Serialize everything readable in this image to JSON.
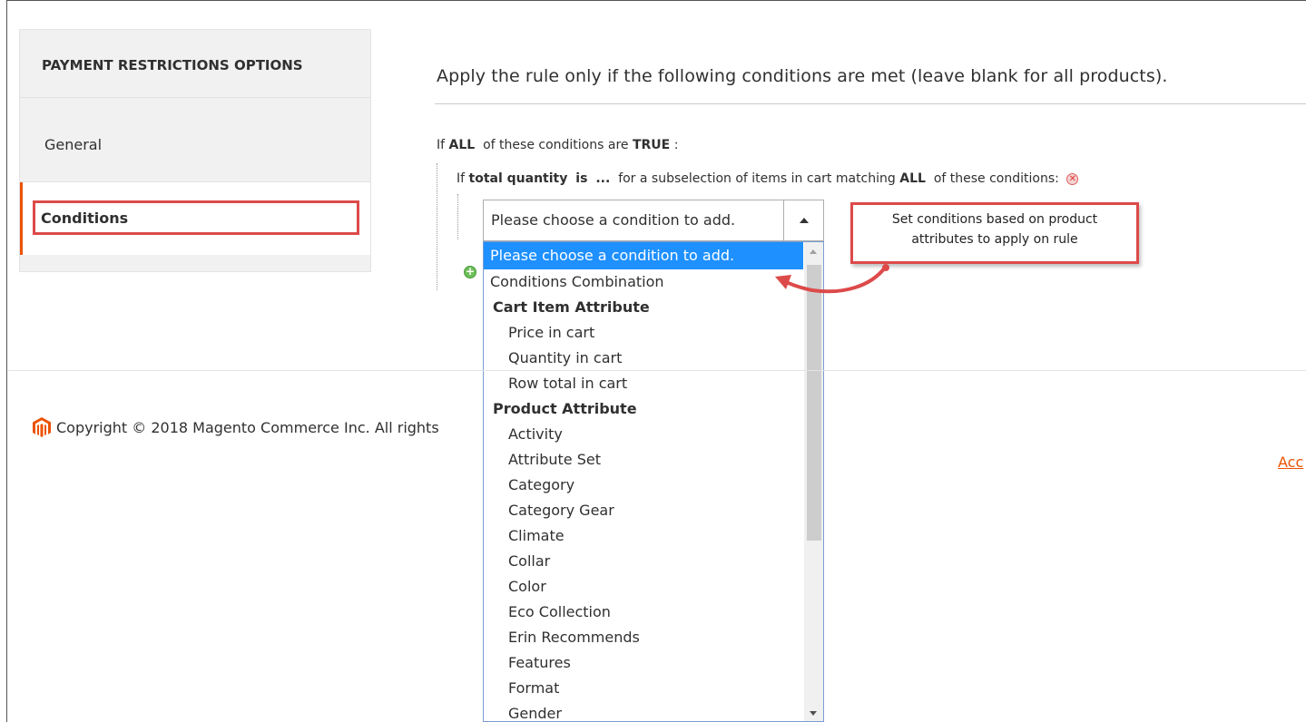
{
  "sidebar": {
    "title": "PAYMENT RESTRICTIONS OPTIONS",
    "items": [
      {
        "label": "General"
      },
      {
        "label": "Conditions"
      }
    ]
  },
  "main": {
    "heading": "Apply the rule only if the following conditions are met (leave blank for all products).",
    "line1": {
      "prefix": "If",
      "aggregator": "ALL",
      "middle": "of these conditions are",
      "value": "TRUE",
      "suffix": ":"
    },
    "line2": {
      "prefix": "If",
      "attr": "total quantity",
      "op": "is",
      "value": "...",
      "middle": "for a subselection of items in cart matching",
      "aggregator": "ALL",
      "suffix": "of these conditions:"
    },
    "select": {
      "value": "Please choose a condition to add."
    },
    "dropdown": {
      "options": [
        {
          "label": "Please choose a condition to add.",
          "kind": "selected"
        },
        {
          "label": "Conditions Combination",
          "kind": "item"
        },
        {
          "label": "Cart Item Attribute",
          "kind": "group"
        },
        {
          "label": "Price in cart",
          "kind": "sub"
        },
        {
          "label": "Quantity in cart",
          "kind": "sub"
        },
        {
          "label": "Row total in cart",
          "kind": "sub"
        },
        {
          "label": "Product Attribute",
          "kind": "group"
        },
        {
          "label": "Activity",
          "kind": "sub"
        },
        {
          "label": "Attribute Set",
          "kind": "sub"
        },
        {
          "label": "Category",
          "kind": "sub"
        },
        {
          "label": "Category Gear",
          "kind": "sub"
        },
        {
          "label": "Climate",
          "kind": "sub"
        },
        {
          "label": "Collar",
          "kind": "sub"
        },
        {
          "label": "Color",
          "kind": "sub"
        },
        {
          "label": "Eco Collection",
          "kind": "sub"
        },
        {
          "label": "Erin Recommends",
          "kind": "sub"
        },
        {
          "label": "Features",
          "kind": "sub"
        },
        {
          "label": "Format",
          "kind": "sub"
        },
        {
          "label": "Gender",
          "kind": "sub"
        }
      ]
    }
  },
  "callout": {
    "line1": "Set conditions based on product",
    "line2": "attributes to apply on rule"
  },
  "footer": {
    "copyright": "Copyright © 2018 Magento Commerce Inc. All rights",
    "link": "Acc"
  },
  "colors": {
    "accent": "#eb5202",
    "highlight_box": "#dd4a4a",
    "selected_option": "#1e90ff"
  },
  "icons": {
    "remove": "remove-condition-icon",
    "add": "add-condition-icon",
    "logo": "magento-logo-icon"
  }
}
